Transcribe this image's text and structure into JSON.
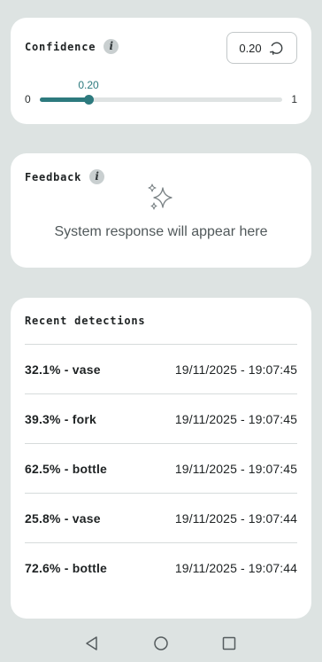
{
  "confidence": {
    "title": "Confidence",
    "info_icon": "i",
    "value_text": "0.20",
    "value": 0.2,
    "min_label": "0",
    "max_label": "1",
    "slider_label": "0.20",
    "reset_icon": "reset-icon",
    "accent_color": "#2d7a7e"
  },
  "feedback": {
    "title": "Feedback",
    "info_icon": "i",
    "icon": "sparkle-icon",
    "placeholder": "System response will appear here"
  },
  "recent": {
    "title": "Recent detections",
    "items": [
      {
        "label": "32.1% - vase",
        "time": "19/11/2025 - 19:07:45"
      },
      {
        "label": "39.3% - fork",
        "time": "19/11/2025 - 19:07:45"
      },
      {
        "label": "62.5% - bottle",
        "time": "19/11/2025 - 19:07:45"
      },
      {
        "label": "25.8% - vase",
        "time": "19/11/2025 - 19:07:44"
      },
      {
        "label": "72.6% - bottle",
        "time": "19/11/2025 - 19:07:44"
      }
    ]
  },
  "nav": {
    "back_icon": "back-triangle-icon",
    "home_icon": "home-circle-icon",
    "recents_icon": "recents-square-icon"
  }
}
